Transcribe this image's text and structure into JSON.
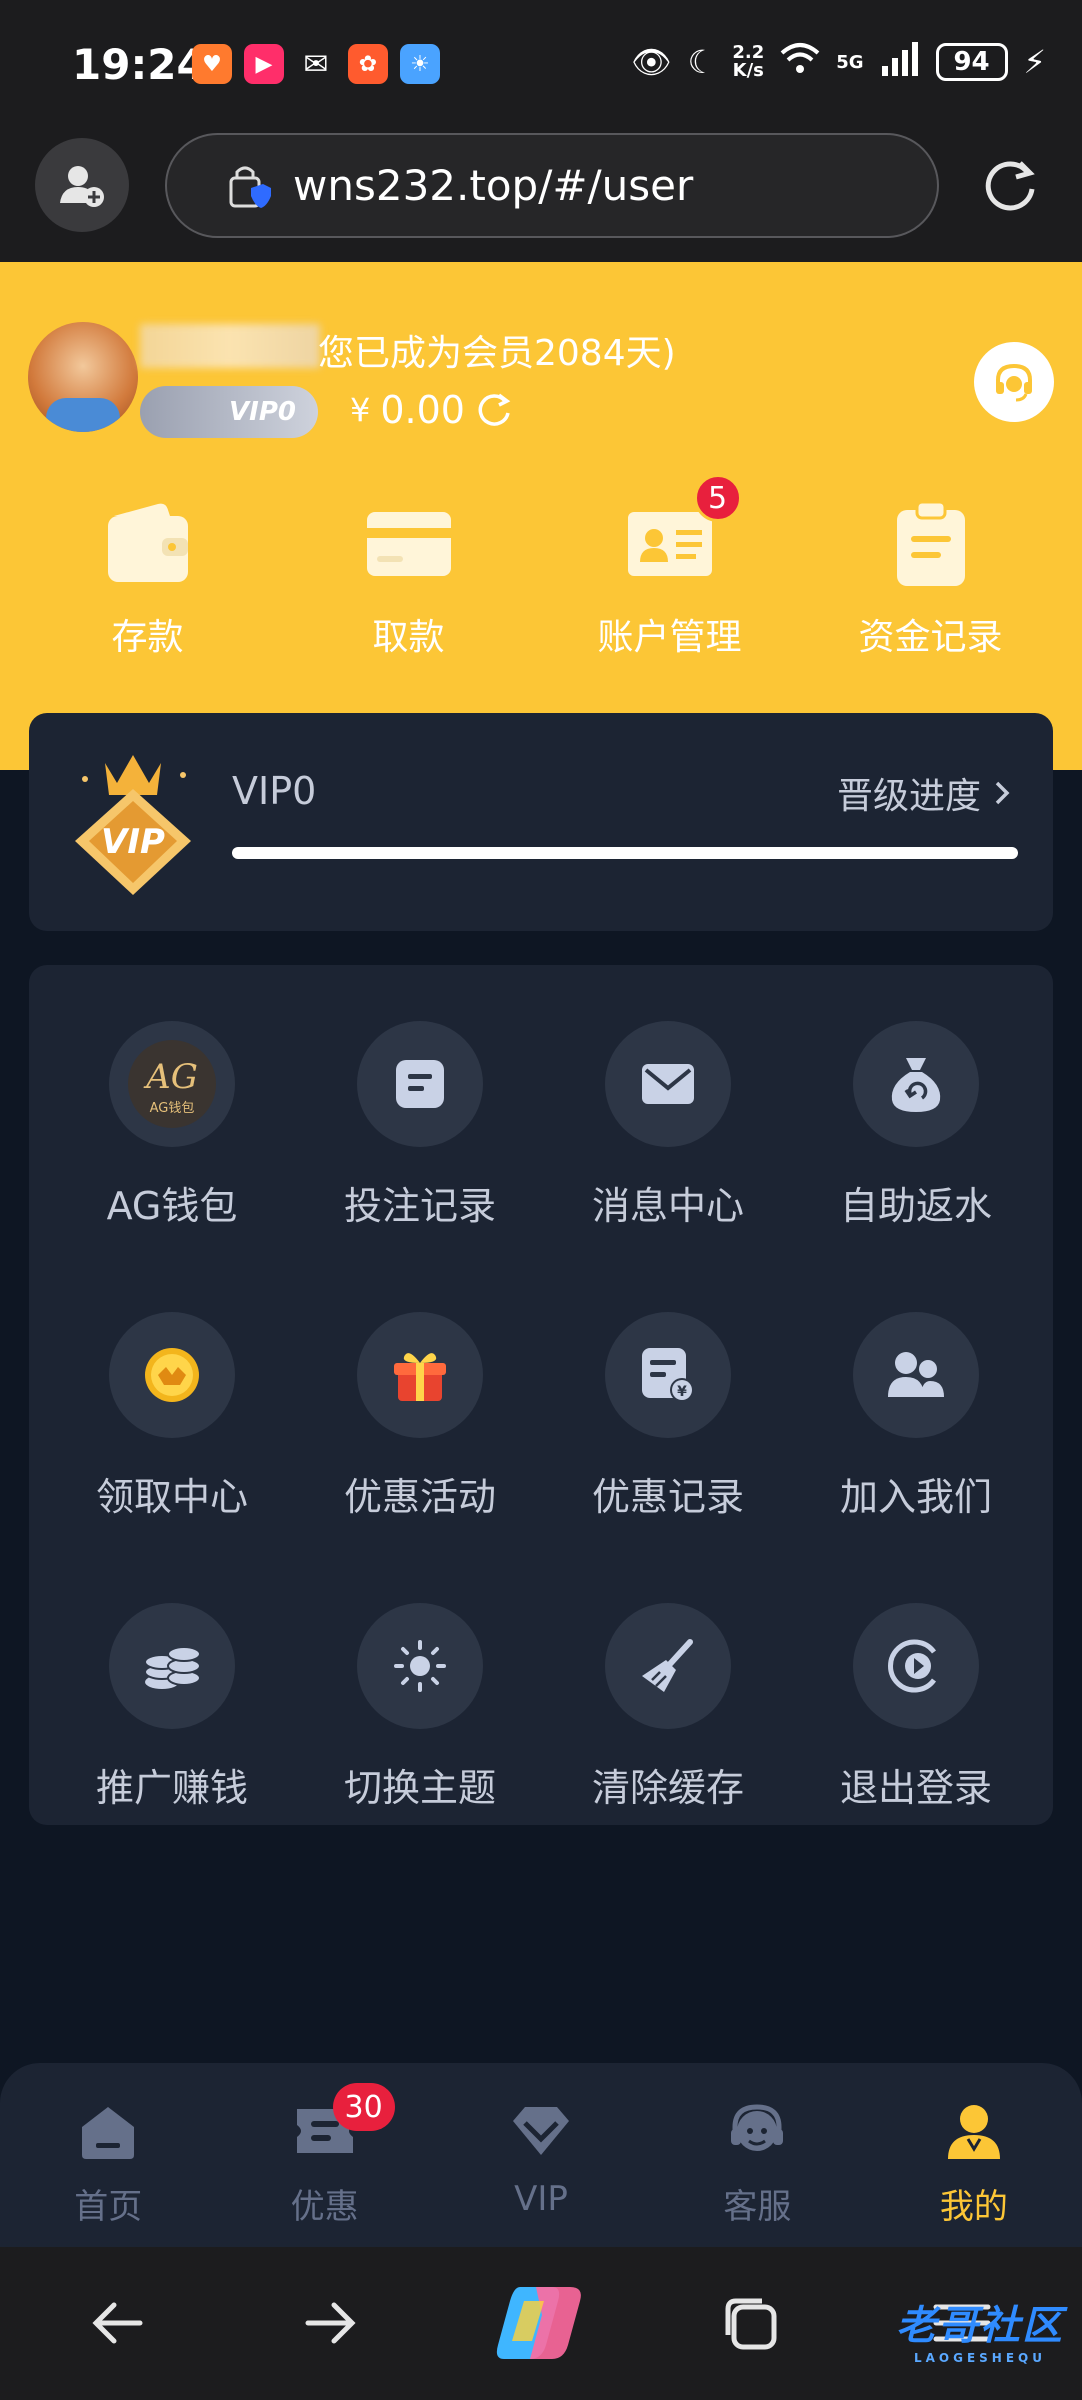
{
  "status_bar": {
    "time": "19:24",
    "net_speed_value": "2.2",
    "net_speed_unit": "K/s",
    "signal": "5G",
    "battery": "94"
  },
  "browser": {
    "url": "wns232.top/#/user"
  },
  "user": {
    "member_text": "您已成为会员2084天)",
    "vip_badge": "VIP0",
    "currency": "¥",
    "balance": "0.00"
  },
  "quick_actions": [
    {
      "label": "存款",
      "icon": "wallet-icon"
    },
    {
      "label": "取款",
      "icon": "card-icon"
    },
    {
      "label": "账户管理",
      "icon": "id-card-icon",
      "badge": "5"
    },
    {
      "label": "资金记录",
      "icon": "clipboard-icon"
    }
  ],
  "vip_card": {
    "emblem_text": "VIP",
    "level": "VIP0",
    "progress_label": "晋级进度",
    "progress": 1.0
  },
  "menu": [
    {
      "label": "AG钱包",
      "icon": "ag-wallet-icon",
      "icon_text": "AG",
      "icon_subtext": "AG钱包"
    },
    {
      "label": "投注记录",
      "icon": "bet-record-icon"
    },
    {
      "label": "消息中心",
      "icon": "mail-icon"
    },
    {
      "label": "自助返水",
      "icon": "money-bag-icon"
    },
    {
      "label": "领取中心",
      "icon": "gold-coin-icon"
    },
    {
      "label": "优惠活动",
      "icon": "gift-icon"
    },
    {
      "label": "优惠记录",
      "icon": "promo-record-icon"
    },
    {
      "label": "加入我们",
      "icon": "users-icon"
    },
    {
      "label": "推广赚钱",
      "icon": "coins-stack-icon"
    },
    {
      "label": "切换主题",
      "icon": "sun-icon"
    },
    {
      "label": "清除缓存",
      "icon": "broom-icon"
    },
    {
      "label": "退出登录",
      "icon": "logout-icon"
    }
  ],
  "tabs": [
    {
      "label": "首页",
      "icon": "home-icon",
      "active": false
    },
    {
      "label": "优惠",
      "icon": "ticket-icon",
      "active": false,
      "badge": "30"
    },
    {
      "label": "VIP",
      "icon": "vip-diamond-icon",
      "active": false
    },
    {
      "label": "客服",
      "icon": "headset-icon",
      "active": false
    },
    {
      "label": "我的",
      "icon": "user-icon",
      "active": true
    }
  ],
  "watermark": {
    "text": "老哥社区",
    "subtext": "LAOGESHEQU"
  },
  "colors": {
    "brand_yellow": "#fcc636",
    "card_bg": "#1c2433",
    "page_bg": "#0e1623",
    "badge_red": "#e8203d",
    "muted_text": "#c6ccda",
    "tab_inactive": "#65708a"
  }
}
